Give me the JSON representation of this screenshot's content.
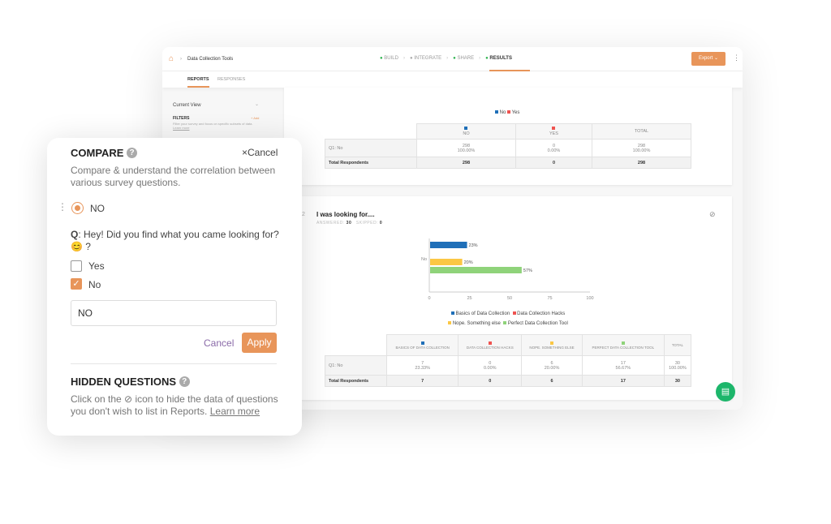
{
  "header": {
    "breadcrumb": "Data Collection Tools",
    "steps": [
      "BUILD",
      "INTEGRATE",
      "SHARE",
      "RESULTS"
    ],
    "export": "Export"
  },
  "tabs": [
    "REPORTS",
    "RESPONSES"
  ],
  "sidebar": {
    "current_view": "Current View",
    "filters": "FILTERS",
    "add": "+ Add",
    "desc": "Filter your survey and focus on specific subsets of data.",
    "learn": "Learn more"
  },
  "q1": {
    "legend": [
      "No",
      "Yes"
    ],
    "cols": [
      "NO",
      "YES",
      "TOTAL"
    ],
    "row_label": "Q1: No",
    "row": [
      [
        "298",
        "100.00%"
      ],
      [
        "0",
        "0.00%"
      ],
      [
        "298",
        "100.00%"
      ]
    ],
    "total_label": "Total Respondents",
    "totals": [
      "298",
      "0",
      "298"
    ]
  },
  "q2": {
    "num": "2",
    "title": "I was looking for....",
    "answered_label": "ANSWERED:",
    "answered": "30",
    "skipped_label": "SKIPPED:",
    "skipped": "0",
    "cols": [
      "BASICS OF DATA COLLECTION",
      "DATA COLLECTION HACKS",
      "NOPE. SOMETHING ELSE",
      "PERFECT DATA COLLECTION TOOL",
      "TOTAL"
    ],
    "row_label": "Q1: No",
    "row": [
      [
        "7",
        "23.33%"
      ],
      [
        "0",
        "0.00%"
      ],
      [
        "6",
        "20.00%"
      ],
      [
        "17",
        "56.67%"
      ],
      [
        "30",
        "100.00%"
      ]
    ],
    "total_label": "Total Respondents",
    "totals": [
      "7",
      "0",
      "6",
      "17",
      "30"
    ]
  },
  "chart_data": {
    "type": "bar",
    "orientation": "horizontal",
    "categories": [
      "No"
    ],
    "series": [
      {
        "name": "Basics of Data Collection",
        "values": [
          23
        ],
        "color": "#1f6fb8"
      },
      {
        "name": "Data Collection Hacks",
        "values": [
          0
        ],
        "color": "#ef5350"
      },
      {
        "name": "Nope. Something else",
        "values": [
          20
        ],
        "color": "#fbc744"
      },
      {
        "name": "Perfect Data Collection Tool",
        "values": [
          57
        ],
        "color": "#8fd37a"
      }
    ],
    "xlim": [
      0,
      100
    ],
    "xticks": [
      "0",
      "25",
      "50",
      "75",
      "100"
    ],
    "data_labels": [
      "23%",
      "20%",
      "57%"
    ],
    "legend": "bottom"
  },
  "compare": {
    "title": "COMPARE",
    "cancel_x": "Cancel",
    "desc": "Compare & understand the correlation between various survey questions.",
    "selected": "NO",
    "q_prefix": "Q",
    "question": ": Hey! Did you find what you came looking for? 😊 ?",
    "options": [
      {
        "label": "Yes",
        "checked": false
      },
      {
        "label": "No",
        "checked": true
      }
    ],
    "input_value": "NO",
    "cancel": "Cancel",
    "apply": "Apply"
  },
  "hidden": {
    "title": "HIDDEN QUESTIONS",
    "text1": "Click on the",
    "text2": "icon to hide the data of questions you don't wish to list in Reports.",
    "learn": "Learn more"
  },
  "colors": {
    "accent": "#e8955a",
    "success": "#2bb24c",
    "chat": "#1db66b"
  }
}
